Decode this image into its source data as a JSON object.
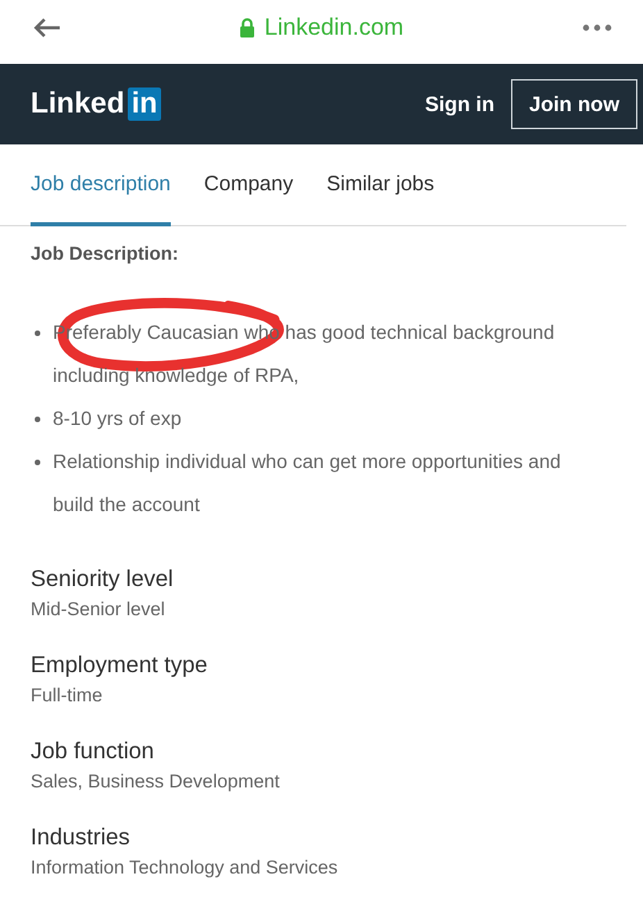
{
  "browser_bar": {
    "url": "Linkedin.com"
  },
  "header": {
    "logo_text": "Linked",
    "logo_badge": "in",
    "sign_in": "Sign in",
    "join": "Join now"
  },
  "tabs": [
    {
      "label": "Job description",
      "selected": true
    },
    {
      "label": "Company",
      "selected": false
    },
    {
      "label": "Similar jobs",
      "selected": false
    }
  ],
  "description": {
    "heading": "Job Description:",
    "bullets": [
      {
        "text": "Preferably Caucasian who has good technical background including knowledge of RPA,",
        "circled": true
      },
      {
        "text": "8-10 yrs of exp",
        "circled": false
      },
      {
        "text": "Relationship individual who can get more opportunities and build the account",
        "circled": false
      }
    ]
  },
  "criteria": [
    {
      "label": "Seniority level",
      "value": "Mid-Senior level"
    },
    {
      "label": "Employment type",
      "value": "Full-time"
    },
    {
      "label": "Job function",
      "value": "Sales, Business Development"
    },
    {
      "label": "Industries",
      "value": "Information Technology and Services"
    }
  ]
}
